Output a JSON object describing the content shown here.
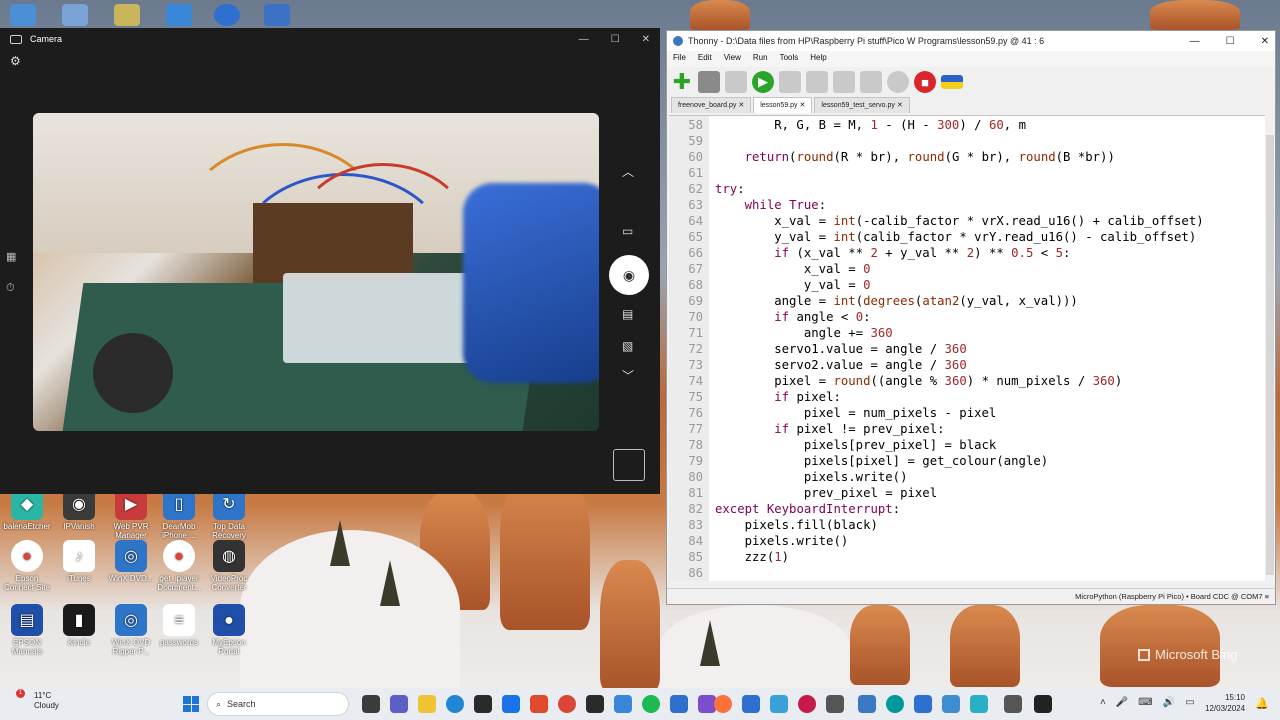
{
  "desktop": {
    "icons": [
      {
        "label": "balenaEtcher",
        "icon": "etcher-icon",
        "color": "#2bb5a4"
      },
      {
        "label": "IPVanish",
        "icon": "vpn-icon",
        "color": "#3b3b3b"
      },
      {
        "label": "Web PVR Manager",
        "icon": "tv-icon",
        "color": "#c73b3b"
      },
      {
        "label": "DearMob iPhone ...",
        "icon": "phone-icon",
        "color": "#2e74c9"
      },
      {
        "label": "Top Data Recovery",
        "icon": "recovery-icon",
        "color": "#2e74c9"
      },
      {
        "label": "Epson Connect Site",
        "icon": "chrome-icon",
        "color": "#ffffff"
      },
      {
        "label": "iTunes",
        "icon": "music-icon",
        "color": "#ffffff"
      },
      {
        "label": "WinX DVD...",
        "icon": "dvd-icon",
        "color": "#2e74c9"
      },
      {
        "label": "get_iplayer Document...",
        "icon": "chrome-icon",
        "color": "#ffffff"
      },
      {
        "label": "VideoProc Converter",
        "icon": "film-icon",
        "color": "#333333"
      },
      {
        "label": "EPSON Manuals",
        "icon": "manual-icon",
        "color": "#1f4fa8"
      },
      {
        "label": "Kindle",
        "icon": "kindle-icon",
        "color": "#1a1a1a"
      },
      {
        "label": "WinX DVD Ripper P...",
        "icon": "dvd-icon",
        "color": "#2e74c9"
      },
      {
        "label": "passwords",
        "icon": "document-icon",
        "color": "#ffffff"
      },
      {
        "label": "MyEpson Portal",
        "icon": "location-icon",
        "color": "#1f4fa8"
      }
    ],
    "watermark": "Microsoft Bing"
  },
  "camera": {
    "title": "Camera",
    "controls": {
      "minimize": "—",
      "maximize": "☐",
      "close": "✕"
    }
  },
  "thonny": {
    "title": "Thonny  -  D:\\Data files from HP\\Raspberry Pi stuff\\Pico W Programs\\lesson59.py  @  41 : 6",
    "controls": {
      "minimize": "—",
      "maximize": "☐",
      "close": "✕"
    },
    "menu": [
      "File",
      "Edit",
      "View",
      "Run",
      "Tools",
      "Help"
    ],
    "tabs": [
      {
        "label": "freenove_board.py ✕",
        "active": false
      },
      {
        "label": "lesson59.py ✕",
        "active": true
      },
      {
        "label": "lesson59_test_servo.py ✕",
        "active": false
      }
    ],
    "code": [
      {
        "n": "58",
        "text": "        R, G, B = M, 1 - (H - 300) / 60, m"
      },
      {
        "n": "59",
        "text": ""
      },
      {
        "n": "60",
        "text": "    return(round(R * br), round(G * br), round(B *br))"
      },
      {
        "n": "61",
        "text": ""
      },
      {
        "n": "62",
        "text": "try:"
      },
      {
        "n": "63",
        "text": "    while True:"
      },
      {
        "n": "64",
        "text": "        x_val = int(-calib_factor * vrX.read_u16() + calib_offset)"
      },
      {
        "n": "65",
        "text": "        y_val = int(calib_factor * vrY.read_u16() - calib_offset)"
      },
      {
        "n": "66",
        "text": "        if (x_val ** 2 + y_val ** 2) ** 0.5 < 5:"
      },
      {
        "n": "67",
        "text": "            x_val = 0"
      },
      {
        "n": "68",
        "text": "            y_val = 0"
      },
      {
        "n": "69",
        "text": "        angle = int(degrees(atan2(y_val, x_val)))"
      },
      {
        "n": "70",
        "text": "        if angle < 0:"
      },
      {
        "n": "71",
        "text": "            angle += 360"
      },
      {
        "n": "72",
        "text": "        servo1.value = angle / 360"
      },
      {
        "n": "73",
        "text": "        servo2.value = angle / 360"
      },
      {
        "n": "74",
        "text": "        pixel = round((angle % 360) * num_pixels / 360)"
      },
      {
        "n": "75",
        "text": "        if pixel:"
      },
      {
        "n": "76",
        "text": "            pixel = num_pixels - pixel"
      },
      {
        "n": "77",
        "text": "        if pixel != prev_pixel:"
      },
      {
        "n": "78",
        "text": "            pixels[prev_pixel] = black"
      },
      {
        "n": "79",
        "text": "            pixels[pixel] = get_colour(angle)"
      },
      {
        "n": "80",
        "text": "            pixels.write()"
      },
      {
        "n": "81",
        "text": "            prev_pixel = pixel"
      },
      {
        "n": "82",
        "text": "except KeyboardInterrupt:"
      },
      {
        "n": "83",
        "text": "    pixels.fill(black)"
      },
      {
        "n": "84",
        "text": "    pixels.write()"
      },
      {
        "n": "85",
        "text": "    zzz(1)"
      },
      {
        "n": "86",
        "text": ""
      }
    ],
    "status": "MicroPython (Raspberry Pi Pico)  •  Board CDC @ COM7  ≡"
  },
  "taskbar": {
    "weather_temp": "11°C",
    "weather_desc": "Cloudy",
    "weather_badge": "1",
    "search_placeholder": "Search",
    "time": "15:10",
    "date": "12/03/2024"
  }
}
